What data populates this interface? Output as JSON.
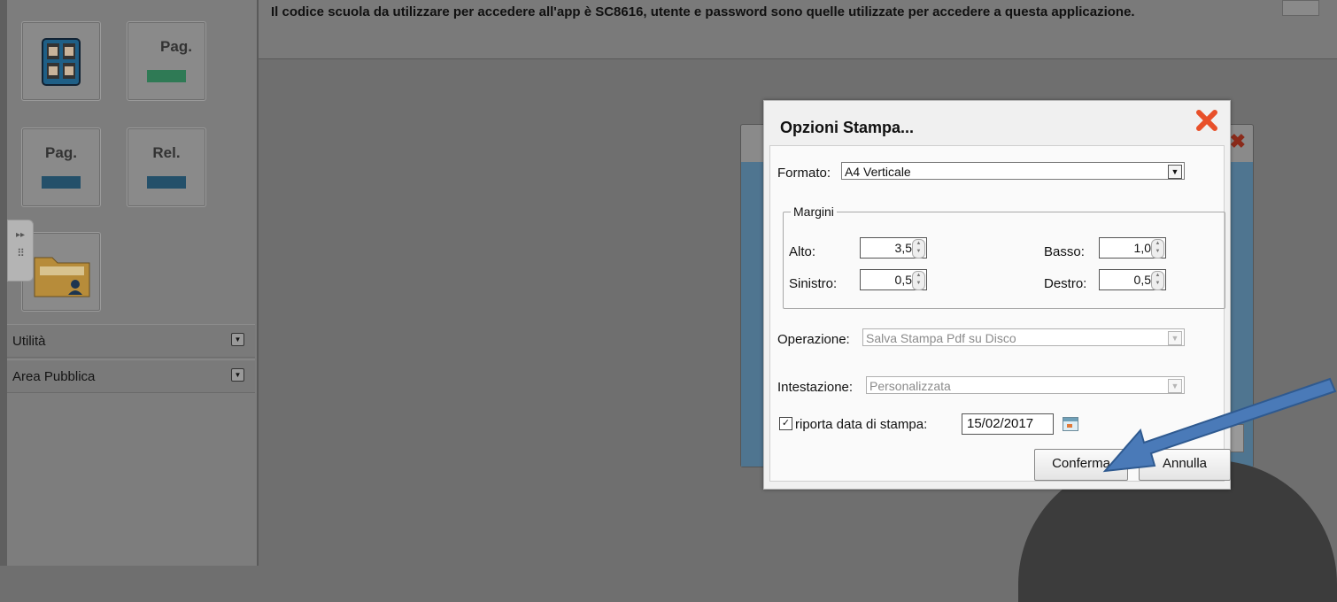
{
  "topbar": {
    "notice": "Il codice scuola da utilizzare per accedere all'app è SC8616, utente e password sono quelle utilizzate per accedere a questa applicazione."
  },
  "sidebar": {
    "tiles": [
      {
        "label": "",
        "icon": "calendar-grid-icon"
      },
      {
        "label": "Pag.",
        "bar_color": "#2f7a55"
      },
      {
        "label": "Pag.",
        "bar_color": "#24506a"
      },
      {
        "label": "Rel.",
        "bar_color": "#24506a"
      },
      {
        "label": "",
        "icon": "folder-user-icon"
      }
    ],
    "expander": {
      "glyph": "▸▸"
    },
    "sections": [
      {
        "label": "Utilità"
      },
      {
        "label": "Area Pubblica"
      }
    ]
  },
  "dialog": {
    "title": "Opzioni Stampa...",
    "formato": {
      "label": "Formato:",
      "value": "A4 Verticale"
    },
    "margini": {
      "legend": "Margini",
      "alto": {
        "label": "Alto:",
        "value": "3,5"
      },
      "basso": {
        "label": "Basso:",
        "value": "1,0"
      },
      "sinistro": {
        "label": "Sinistro:",
        "value": "0,5"
      },
      "destro": {
        "label": "Destro:",
        "value": "0,5"
      }
    },
    "operazione": {
      "label": "Operazione:",
      "value": "Salva Stampa Pdf su Disco"
    },
    "intestazione": {
      "label": "Intestazione:",
      "value": "Personalizzata"
    },
    "data_stampa": {
      "checked": true,
      "label": "riporta data di stampa:",
      "value": "15/02/2017"
    },
    "buttons": {
      "confirm": "Conferma",
      "cancel": "Annulla"
    }
  },
  "colors": {
    "close_red": "#e8502a",
    "annotation_arrow": "#4a7ab8"
  }
}
